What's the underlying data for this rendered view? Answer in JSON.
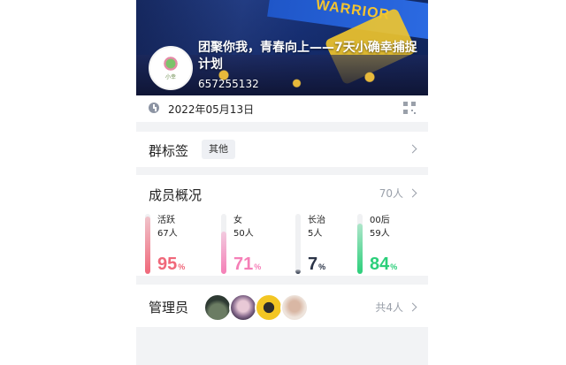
{
  "header": {
    "title": "团聚你我，青春向上——7天小确幸捕捉计划",
    "group_id": "657255132",
    "flag_text": "WARRIOR"
  },
  "date_row": {
    "date": "2022年05月13日",
    "clock_icon": "clock-icon",
    "qr_icon": "qr-code-icon"
  },
  "tags": {
    "title": "群标签",
    "tag": "其他"
  },
  "members": {
    "title": "成员概况",
    "count": "70人",
    "stats": [
      {
        "label": "活跃",
        "value": "67人",
        "percent": "95",
        "pct_sign": "%",
        "level": 0.95,
        "color": "#f0687a"
      },
      {
        "label": "女",
        "value": "50人",
        "percent": "71",
        "pct_sign": "%",
        "level": 0.71,
        "color": "#f57fb7"
      },
      {
        "label": "长治",
        "value": "5人",
        "percent": "7",
        "pct_sign": "%",
        "level": 0.07,
        "color": "#2b3447"
      },
      {
        "label": "00后",
        "value": "59人",
        "percent": "84",
        "pct_sign": "%",
        "level": 0.84,
        "color": "#2bcf7a"
      }
    ]
  },
  "admins": {
    "title": "管理员",
    "count": "共4人"
  }
}
